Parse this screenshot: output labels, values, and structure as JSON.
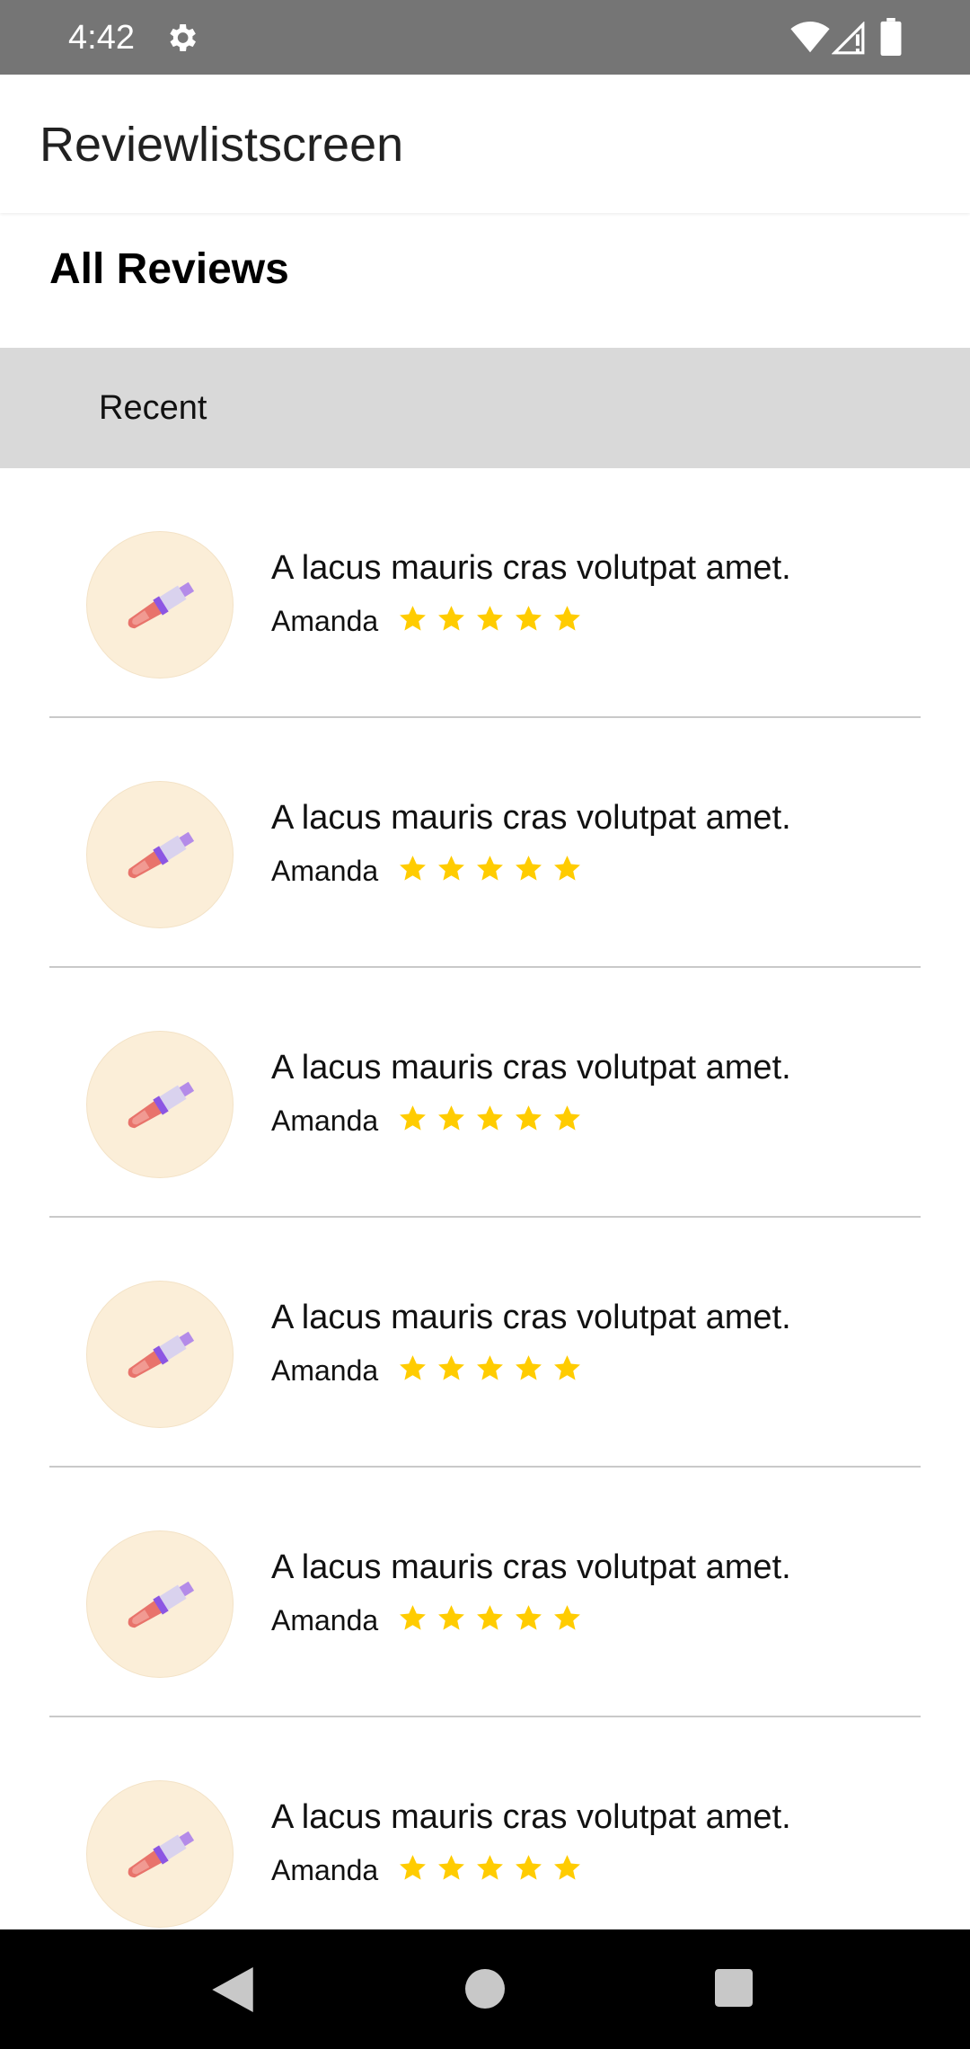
{
  "status_bar": {
    "time": "4:42",
    "icons": [
      "gear-icon",
      "wifi-icon",
      "signal-icon",
      "battery-icon"
    ]
  },
  "app_bar": {
    "title": "Reviewlistscreen"
  },
  "section": {
    "title": "All Reviews"
  },
  "filter": {
    "label": "Recent"
  },
  "reviews": [
    {
      "text": "A lacus mauris cras volutpat amet.",
      "author": "Amanda",
      "rating": 5
    },
    {
      "text": "A lacus mauris cras volutpat amet.",
      "author": "Amanda",
      "rating": 5
    },
    {
      "text": "A lacus mauris cras volutpat amet.",
      "author": "Amanda",
      "rating": 5
    },
    {
      "text": "A lacus mauris cras volutpat amet.",
      "author": "Amanda",
      "rating": 5
    },
    {
      "text": "A lacus mauris cras volutpat amet.",
      "author": "Amanda",
      "rating": 5
    },
    {
      "text": "A lacus mauris cras volutpat amet.",
      "author": "Amanda",
      "rating": 5
    }
  ],
  "colors": {
    "status_bar": "#757575",
    "filter_bar": "#d9d9d9",
    "avatar_bg": "#fbeed8",
    "star": "#ffcc00",
    "nav_bar": "#000000"
  },
  "nav": {
    "icons": [
      "back-icon",
      "home-icon",
      "recents-icon"
    ]
  }
}
